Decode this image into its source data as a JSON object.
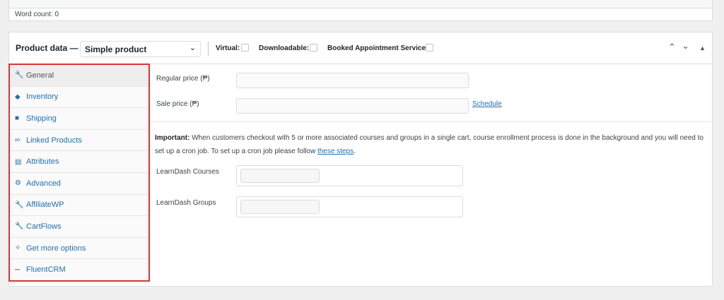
{
  "editor": {
    "word_count": "Word count: 0"
  },
  "product_data": {
    "label": "Product data —",
    "type_selected": "Simple product",
    "options": [
      {
        "label": "Virtual:"
      },
      {
        "label": "Downloadable:"
      },
      {
        "label": "Booked Appointment Service:"
      }
    ]
  },
  "tabs": [
    {
      "label": "General",
      "icon": "wrench-icon",
      "active": true
    },
    {
      "label": "Inventory",
      "icon": "tag-icon"
    },
    {
      "label": "Shipping",
      "icon": "truck-icon"
    },
    {
      "label": "Linked Products",
      "icon": "link-icon"
    },
    {
      "label": "Attributes",
      "icon": "table-icon"
    },
    {
      "label": "Advanced",
      "icon": "gear-icon"
    },
    {
      "label": "AffiliateWP",
      "icon": "wrench-icon"
    },
    {
      "label": "CartFlows",
      "icon": "wrench-icon"
    },
    {
      "label": "Get more options",
      "icon": "plugin-icon"
    },
    {
      "label": "FluentCRM",
      "icon": "fluentcrm-icon"
    }
  ],
  "general": {
    "regular_price_label": "Regular price (₱)",
    "sale_price_label": "Sale price (₱)",
    "schedule_link": "Schedule",
    "notice_strong": "Important:",
    "notice_text": " When customers checkout with 5 or more associated courses and groups in a single cart, course enrollment process is done in the background and you will need to set up a cron job. To set up a cron job please follow ",
    "notice_link": "these steps",
    "notice_end": ".",
    "courses_label": "LearnDash Courses",
    "groups_label": "LearnDash Groups"
  },
  "colors": {
    "link": "#2271b1",
    "highlight_border": "#d63638"
  }
}
